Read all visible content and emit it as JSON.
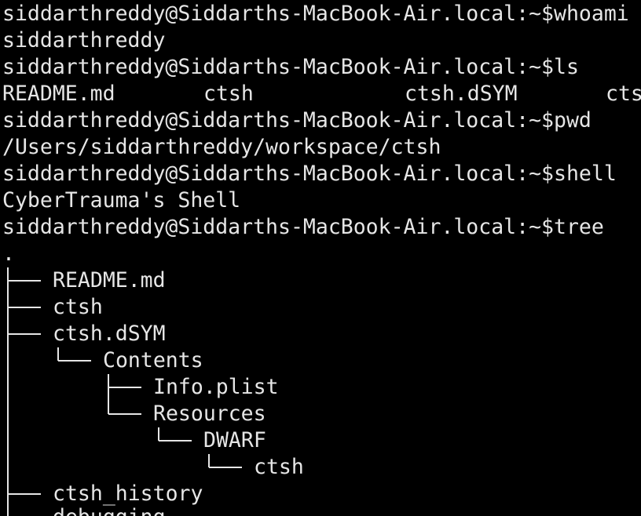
{
  "terminal": {
    "colors": {
      "background": "#000000",
      "text": "#e6e6e6"
    },
    "prompt": "siddarthreddy@Siddarths-MacBook-Air.local:~$",
    "session": [
      {
        "command": "whoami",
        "output": "siddarthreddy"
      },
      {
        "command": "ls",
        "ls_items": [
          "README.md",
          "ctsh",
          "ctsh.dSYM",
          "cts"
        ]
      },
      {
        "command": "pwd",
        "output": "/Users/siddarthreddy/workspace/ctsh"
      },
      {
        "command": "shell",
        "output": "CyberTrauma's Shell"
      },
      {
        "command": "tree"
      }
    ],
    "tree": {
      "root": ".",
      "entries": [
        "README.md",
        "ctsh",
        "ctsh.dSYM",
        "Contents",
        "Info.plist",
        "Resources",
        "DWARF",
        "ctsh",
        "ctsh_history",
        "debugging"
      ]
    }
  }
}
